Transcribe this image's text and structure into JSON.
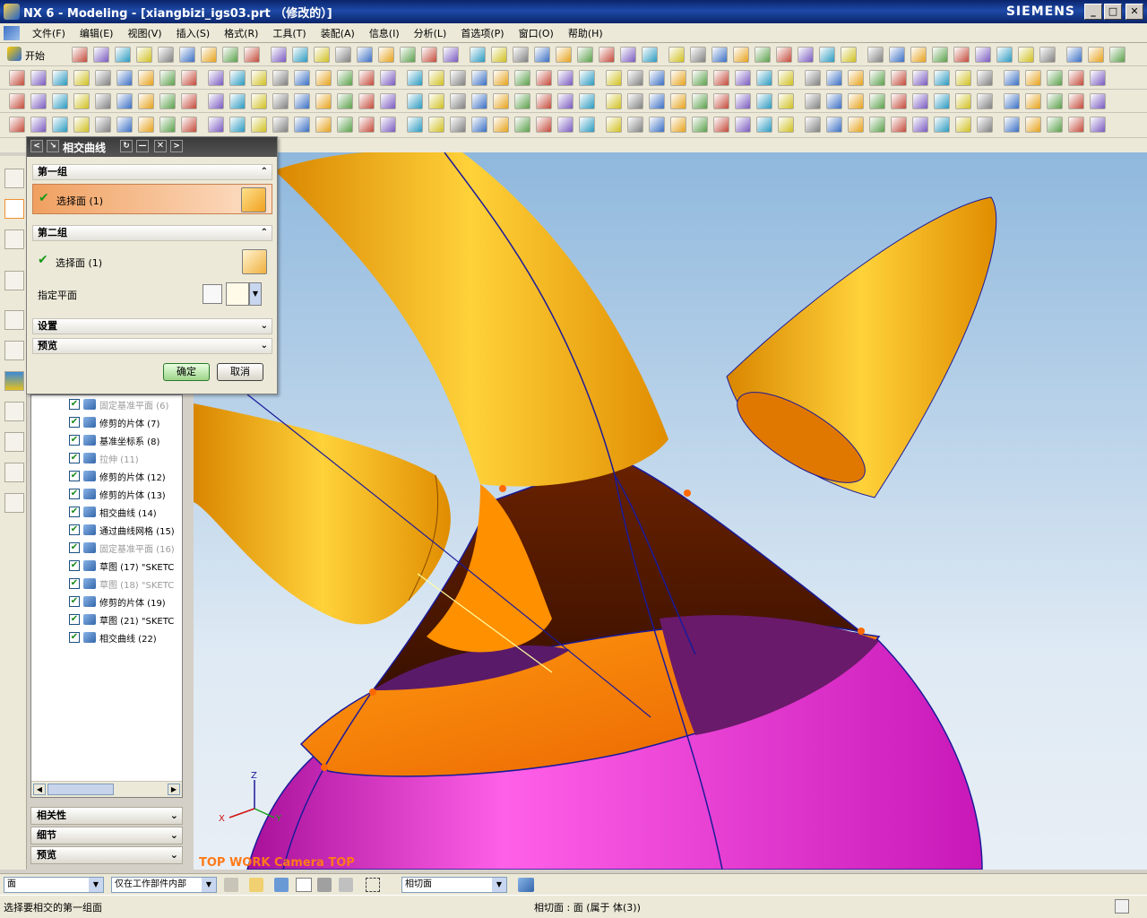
{
  "window": {
    "title": "NX 6 - Modeling - [xiangbizi_igs03.prt （修改的）]",
    "brand": "SIEMENS"
  },
  "menu": [
    "文件(F)",
    "编辑(E)",
    "视图(V)",
    "插入(S)",
    "格式(R)",
    "工具(T)",
    "装配(A)",
    "信息(I)",
    "分析(L)",
    "首选项(P)",
    "窗口(O)",
    "帮助(H)"
  ],
  "toolbar": {
    "start_label": "开始"
  },
  "dialog": {
    "title": "相交曲线",
    "group1": {
      "label": "第一组",
      "select": "选择面 (1)"
    },
    "group2": {
      "label": "第二组",
      "select": "选择面 (1)",
      "plane_label": "指定平面"
    },
    "settings": "设置",
    "preview": "预览",
    "ok": "确定",
    "cancel": "取消"
  },
  "tree": {
    "items": [
      {
        "label": "固定基准平面 (6)",
        "dim": true
      },
      {
        "label": "修剪的片体 (7)",
        "dim": false
      },
      {
        "label": "基准坐标系 (8)",
        "dim": false
      },
      {
        "label": "拉伸 (11)",
        "dim": true
      },
      {
        "label": "修剪的片体 (12)",
        "dim": false
      },
      {
        "label": "修剪的片体 (13)",
        "dim": false
      },
      {
        "label": "相交曲线 (14)",
        "dim": false
      },
      {
        "label": "通过曲线网格 (15)",
        "dim": false
      },
      {
        "label": "固定基准平面 (16)",
        "dim": true
      },
      {
        "label": "草图 (17) \"SKETC",
        "dim": false
      },
      {
        "label": "草图 (18) \"SKETC",
        "dim": true
      },
      {
        "label": "修剪的片体 (19)",
        "dim": false
      },
      {
        "label": "草图 (21) \"SKETC",
        "dim": false
      },
      {
        "label": "相交曲线 (22)",
        "dim": false
      }
    ],
    "panels": [
      "相关性",
      "细节",
      "预览"
    ]
  },
  "viewport": {
    "caption": "TOP WORK Camera TOP",
    "axes": {
      "x": "X",
      "y": "Y",
      "z": "Z"
    }
  },
  "statusbar": {
    "filter1": "面",
    "filter2": "仅在工作部件内部",
    "filter3": "相切面",
    "prompt": "选择要相交的第一组面",
    "info": "相切面 : 面 (属于 体(3))"
  }
}
